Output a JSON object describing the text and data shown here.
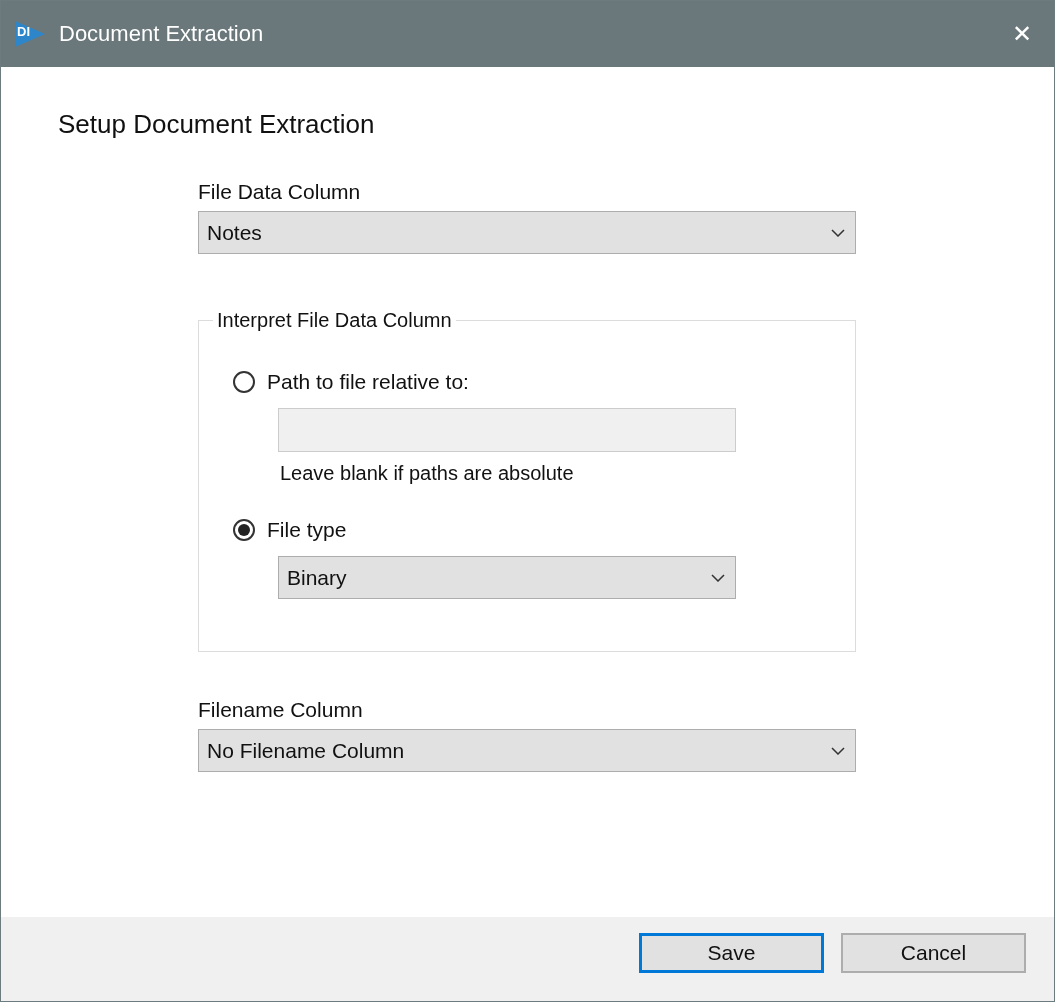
{
  "window": {
    "logo_text": "DI",
    "title": "Document Extraction",
    "close": "✕"
  },
  "heading": "Setup Document Extraction",
  "file_data_column": {
    "label": "File Data Column",
    "value": "Notes"
  },
  "interpret": {
    "legend": "Interpret File Data Column",
    "options": [
      {
        "kind": "path",
        "label": "Path to file relative to:",
        "selected": false,
        "hint": "Leave blank if paths are absolute"
      },
      {
        "kind": "type",
        "label": "File type",
        "selected": true,
        "value": "Binary"
      }
    ]
  },
  "filename_column": {
    "label": "Filename Column",
    "value": "No Filename Column"
  },
  "buttons": [
    {
      "label": "Save",
      "focused": true
    },
    {
      "label": "Cancel",
      "focused": false
    }
  ]
}
